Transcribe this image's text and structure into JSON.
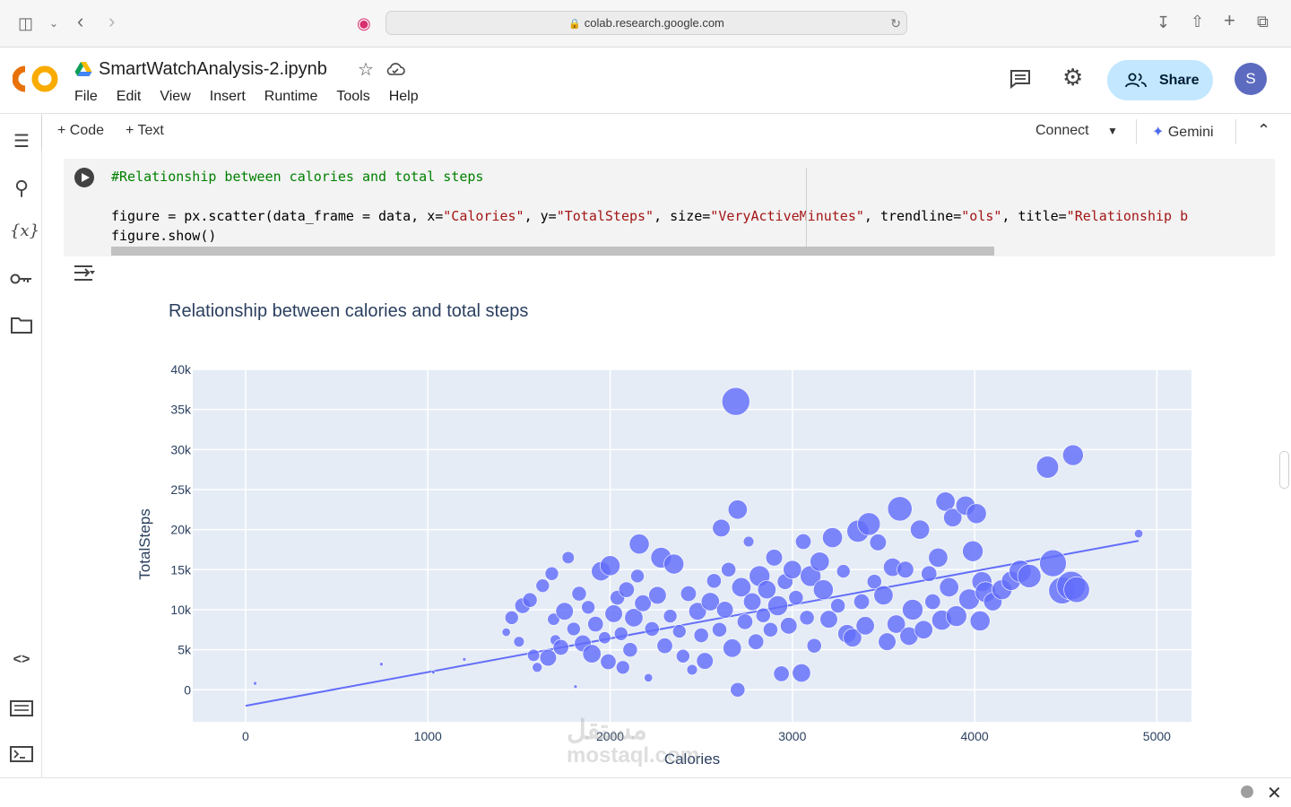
{
  "browser": {
    "url": "colab.research.google.com",
    "icons": [
      "sidebar-toggle-icon",
      "chevron-down-icon",
      "back-icon",
      "forward-icon",
      "media-icon",
      "lock-icon",
      "reload-icon",
      "download-icon",
      "share-icon",
      "new-tab-icon",
      "tabs-icon"
    ]
  },
  "header": {
    "notebook_name": "SmartWatchAnalysis-2.ipynb",
    "menu": [
      "File",
      "Edit",
      "View",
      "Insert",
      "Runtime",
      "Tools",
      "Help"
    ],
    "share_label": "Share",
    "avatar_letter": "S"
  },
  "toolbar": {
    "add_code": "Code",
    "add_text": "Text",
    "connect": "Connect",
    "gemini": "Gemini"
  },
  "cell": {
    "comment_line": "#Relationship between calories and total steps",
    "code_line_2_parts": [
      "figure = px.scatter(data_frame = data, x=",
      "\"Calories\"",
      ", y=",
      "\"TotalSteps\"",
      ", size=",
      "\"VeryActiveMinutes\"",
      ", trendline=",
      "\"ols\"",
      ", title=",
      "\"Relationship b"
    ],
    "code_line_3": "figure.show()"
  },
  "watermark": {
    "text_ar": "مستقل",
    "text_en": "mostaql.com"
  },
  "colors": {
    "marker": "#636efa",
    "plot_bg": "#e5ecf6",
    "share_bg": "#c2e7ff",
    "avatar_bg": "#5c6bc0",
    "logo_orange": "#f9ab00",
    "logo_dark_orange": "#e8710a"
  },
  "chart_data": {
    "type": "scatter",
    "title": "Relationship between calories and total steps",
    "xlabel": "Calories",
    "ylabel": "TotalSteps",
    "xlim": [
      -290,
      5190
    ],
    "ylim": [
      -4000,
      40000
    ],
    "x_ticks": [
      0,
      1000,
      2000,
      3000,
      4000,
      5000
    ],
    "x_tick_labels": [
      "0",
      "1000",
      "2000",
      "3000",
      "4000",
      "5000"
    ],
    "y_ticks": [
      0,
      5000,
      10000,
      15000,
      20000,
      25000,
      30000,
      35000,
      40000
    ],
    "y_tick_labels": [
      "0",
      "5k",
      "10k",
      "15k",
      "20k",
      "25k",
      "30k",
      "35k",
      "40k"
    ],
    "grid": true,
    "size_field": "VeryActiveMinutes",
    "trendline": {
      "type": "ols",
      "x": [
        0,
        4900
      ],
      "y": [
        -2000,
        18600
      ]
    },
    "points": [
      {
        "x": 52,
        "y": 800,
        "s": 0
      },
      {
        "x": 745,
        "y": 3200,
        "s": 0
      },
      {
        "x": 1200,
        "y": 3800,
        "s": 0
      },
      {
        "x": 1030,
        "y": 2200,
        "s": 0
      },
      {
        "x": 1430,
        "y": 7200,
        "s": 5
      },
      {
        "x": 1460,
        "y": 9000,
        "s": 20
      },
      {
        "x": 1500,
        "y": 6000,
        "s": 10
      },
      {
        "x": 1520,
        "y": 10500,
        "s": 30
      },
      {
        "x": 1560,
        "y": 11200,
        "s": 25
      },
      {
        "x": 1580,
        "y": 4300,
        "s": 15
      },
      {
        "x": 1600,
        "y": 2800,
        "s": 8
      },
      {
        "x": 1630,
        "y": 13000,
        "s": 20
      },
      {
        "x": 1660,
        "y": 4000,
        "s": 35
      },
      {
        "x": 1680,
        "y": 14500,
        "s": 20
      },
      {
        "x": 1690,
        "y": 8800,
        "s": 15
      },
      {
        "x": 1700,
        "y": 6200,
        "s": 10
      },
      {
        "x": 1730,
        "y": 5300,
        "s": 30
      },
      {
        "x": 1750,
        "y": 9800,
        "s": 40
      },
      {
        "x": 1770,
        "y": 16500,
        "s": 15
      },
      {
        "x": 1800,
        "y": 7600,
        "s": 20
      },
      {
        "x": 1810,
        "y": 400,
        "s": 0
      },
      {
        "x": 1830,
        "y": 12000,
        "s": 25
      },
      {
        "x": 1850,
        "y": 5800,
        "s": 35
      },
      {
        "x": 1880,
        "y": 10300,
        "s": 20
      },
      {
        "x": 1900,
        "y": 4500,
        "s": 45
      },
      {
        "x": 1920,
        "y": 8200,
        "s": 30
      },
      {
        "x": 1950,
        "y": 14800,
        "s": 50
      },
      {
        "x": 1970,
        "y": 6500,
        "s": 15
      },
      {
        "x": 1990,
        "y": 3500,
        "s": 30
      },
      {
        "x": 2000,
        "y": 15500,
        "s": 55
      },
      {
        "x": 2020,
        "y": 9500,
        "s": 40
      },
      {
        "x": 2040,
        "y": 11500,
        "s": 25
      },
      {
        "x": 2060,
        "y": 7000,
        "s": 20
      },
      {
        "x": 2070,
        "y": 2800,
        "s": 20
      },
      {
        "x": 2090,
        "y": 12500,
        "s": 30
      },
      {
        "x": 2110,
        "y": 5000,
        "s": 25
      },
      {
        "x": 2130,
        "y": 9000,
        "s": 45
      },
      {
        "x": 2150,
        "y": 14200,
        "s": 20
      },
      {
        "x": 2160,
        "y": 18200,
        "s": 55
      },
      {
        "x": 2180,
        "y": 10800,
        "s": 35
      },
      {
        "x": 2210,
        "y": 1500,
        "s": 5
      },
      {
        "x": 2230,
        "y": 7600,
        "s": 25
      },
      {
        "x": 2260,
        "y": 11800,
        "s": 40
      },
      {
        "x": 2280,
        "y": 16500,
        "s": 60
      },
      {
        "x": 2300,
        "y": 5500,
        "s": 30
      },
      {
        "x": 2330,
        "y": 9200,
        "s": 20
      },
      {
        "x": 2350,
        "y": 15700,
        "s": 55
      },
      {
        "x": 2380,
        "y": 7300,
        "s": 20
      },
      {
        "x": 2400,
        "y": 4200,
        "s": 20
      },
      {
        "x": 2430,
        "y": 12000,
        "s": 30
      },
      {
        "x": 2450,
        "y": 2500,
        "s": 10
      },
      {
        "x": 2480,
        "y": 9800,
        "s": 40
      },
      {
        "x": 2500,
        "y": 6800,
        "s": 25
      },
      {
        "x": 2520,
        "y": 3600,
        "s": 35
      },
      {
        "x": 2550,
        "y": 11000,
        "s": 45
      },
      {
        "x": 2570,
        "y": 13600,
        "s": 25
      },
      {
        "x": 2600,
        "y": 7500,
        "s": 25
      },
      {
        "x": 2610,
        "y": 20200,
        "s": 40
      },
      {
        "x": 2630,
        "y": 10000,
        "s": 35
      },
      {
        "x": 2650,
        "y": 15000,
        "s": 25
      },
      {
        "x": 2670,
        "y": 5200,
        "s": 45
      },
      {
        "x": 2690,
        "y": 36000,
        "s": 120
      },
      {
        "x": 2700,
        "y": 22500,
        "s": 50
      },
      {
        "x": 2700,
        "y": 0,
        "s": 25
      },
      {
        "x": 2720,
        "y": 12800,
        "s": 50
      },
      {
        "x": 2740,
        "y": 8500,
        "s": 30
      },
      {
        "x": 2760,
        "y": 18500,
        "s": 10
      },
      {
        "x": 2780,
        "y": 11000,
        "s": 40
      },
      {
        "x": 2800,
        "y": 6000,
        "s": 30
      },
      {
        "x": 2820,
        "y": 14200,
        "s": 60
      },
      {
        "x": 2840,
        "y": 9300,
        "s": 25
      },
      {
        "x": 2860,
        "y": 12500,
        "s": 45
      },
      {
        "x": 2880,
        "y": 7500,
        "s": 25
      },
      {
        "x": 2900,
        "y": 16500,
        "s": 35
      },
      {
        "x": 2920,
        "y": 10500,
        "s": 55
      },
      {
        "x": 2940,
        "y": 2000,
        "s": 30
      },
      {
        "x": 2960,
        "y": 13500,
        "s": 30
      },
      {
        "x": 2980,
        "y": 8000,
        "s": 35
      },
      {
        "x": 3000,
        "y": 15000,
        "s": 45
      },
      {
        "x": 3020,
        "y": 11500,
        "s": 25
      },
      {
        "x": 3050,
        "y": 2100,
        "s": 45
      },
      {
        "x": 3060,
        "y": 18500,
        "s": 30
      },
      {
        "x": 3080,
        "y": 9000,
        "s": 25
      },
      {
        "x": 3100,
        "y": 14200,
        "s": 60
      },
      {
        "x": 3120,
        "y": 5500,
        "s": 25
      },
      {
        "x": 3150,
        "y": 16000,
        "s": 50
      },
      {
        "x": 3170,
        "y": 12500,
        "s": 55
      },
      {
        "x": 3200,
        "y": 8800,
        "s": 40
      },
      {
        "x": 3220,
        "y": 19000,
        "s": 55
      },
      {
        "x": 3250,
        "y": 10500,
        "s": 25
      },
      {
        "x": 3280,
        "y": 14800,
        "s": 20
      },
      {
        "x": 3300,
        "y": 7000,
        "s": 45
      },
      {
        "x": 3330,
        "y": 6500,
        "s": 45
      },
      {
        "x": 3360,
        "y": 19800,
        "s": 70
      },
      {
        "x": 3380,
        "y": 11000,
        "s": 30
      },
      {
        "x": 3400,
        "y": 8000,
        "s": 45
      },
      {
        "x": 3420,
        "y": 20700,
        "s": 75
      },
      {
        "x": 3450,
        "y": 13500,
        "s": 25
      },
      {
        "x": 3470,
        "y": 18400,
        "s": 35
      },
      {
        "x": 3500,
        "y": 11800,
        "s": 50
      },
      {
        "x": 3520,
        "y": 6000,
        "s": 40
      },
      {
        "x": 3550,
        "y": 15300,
        "s": 45
      },
      {
        "x": 3570,
        "y": 8200,
        "s": 45
      },
      {
        "x": 3590,
        "y": 22600,
        "s": 90
      },
      {
        "x": 3620,
        "y": 15000,
        "s": 35
      },
      {
        "x": 3640,
        "y": 6700,
        "s": 45
      },
      {
        "x": 3660,
        "y": 10000,
        "s": 60
      },
      {
        "x": 3700,
        "y": 20000,
        "s": 50
      },
      {
        "x": 3720,
        "y": 7500,
        "s": 45
      },
      {
        "x": 3750,
        "y": 14500,
        "s": 30
      },
      {
        "x": 3770,
        "y": 11000,
        "s": 30
      },
      {
        "x": 3800,
        "y": 16500,
        "s": 50
      },
      {
        "x": 3820,
        "y": 8700,
        "s": 55
      },
      {
        "x": 3840,
        "y": 23500,
        "s": 50
      },
      {
        "x": 3860,
        "y": 12800,
        "s": 50
      },
      {
        "x": 3880,
        "y": 21500,
        "s": 45
      },
      {
        "x": 3900,
        "y": 9200,
        "s": 60
      },
      {
        "x": 3950,
        "y": 23000,
        "s": 50
      },
      {
        "x": 3970,
        "y": 11300,
        "s": 60
      },
      {
        "x": 3990,
        "y": 17300,
        "s": 60
      },
      {
        "x": 4010,
        "y": 22000,
        "s": 55
      },
      {
        "x": 4030,
        "y": 8600,
        "s": 55
      },
      {
        "x": 4040,
        "y": 13500,
        "s": 55
      },
      {
        "x": 4060,
        "y": 12200,
        "s": 60
      },
      {
        "x": 4100,
        "y": 11000,
        "s": 45
      },
      {
        "x": 4150,
        "y": 12500,
        "s": 55
      },
      {
        "x": 4200,
        "y": 13600,
        "s": 50
      },
      {
        "x": 4250,
        "y": 14800,
        "s": 70
      },
      {
        "x": 4300,
        "y": 14200,
        "s": 80
      },
      {
        "x": 4400,
        "y": 27800,
        "s": 70
      },
      {
        "x": 4430,
        "y": 15800,
        "s": 110
      },
      {
        "x": 4480,
        "y": 12400,
        "s": 110
      },
      {
        "x": 4530,
        "y": 13000,
        "s": 130
      },
      {
        "x": 4540,
        "y": 29300,
        "s": 60
      },
      {
        "x": 4560,
        "y": 12500,
        "s": 100
      },
      {
        "x": 4900,
        "y": 19500,
        "s": 5
      }
    ]
  }
}
